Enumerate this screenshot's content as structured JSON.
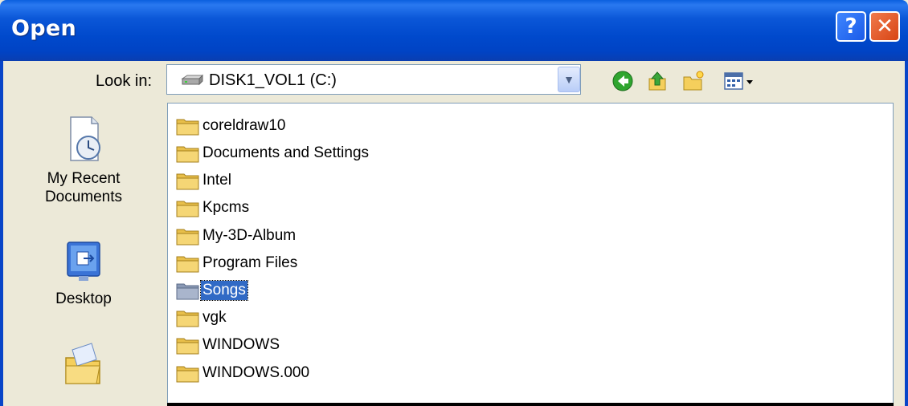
{
  "window": {
    "title": "Open"
  },
  "title_buttons": {
    "help": "?",
    "close": "✕"
  },
  "look_in": {
    "label": "Look in:",
    "value": "DISK1_VOL1 (C:)",
    "dropdown_arrow": "▼"
  },
  "toolbar": {
    "icons": [
      "back-icon",
      "up-folder-icon",
      "new-folder-icon",
      "views-menu-icon"
    ]
  },
  "places_bar": {
    "items": [
      {
        "label_line1": "My Recent",
        "label_line2": "Documents",
        "icon": "recent-documents-icon"
      },
      {
        "label_line1": "Desktop",
        "label_line2": "",
        "icon": "desktop-icon"
      },
      {
        "label_line1": "",
        "label_line2": "",
        "icon": "my-documents-icon"
      }
    ]
  },
  "files": [
    {
      "name": "coreldraw10",
      "selected": false
    },
    {
      "name": "Documents and Settings",
      "selected": false
    },
    {
      "name": "Intel",
      "selected": false
    },
    {
      "name": "Kpcms",
      "selected": false
    },
    {
      "name": "My-3D-Album",
      "selected": false
    },
    {
      "name": "Program Files",
      "selected": false
    },
    {
      "name": "Songs",
      "selected": true
    },
    {
      "name": "vgk",
      "selected": false
    },
    {
      "name": "WINDOWS",
      "selected": false
    },
    {
      "name": "WINDOWS.000",
      "selected": false
    }
  ],
  "colors": {
    "titlebar": "#0054e3",
    "dialog_bg": "#ece9d8",
    "selection": "#316ac5",
    "folder": "#f3d57c"
  }
}
